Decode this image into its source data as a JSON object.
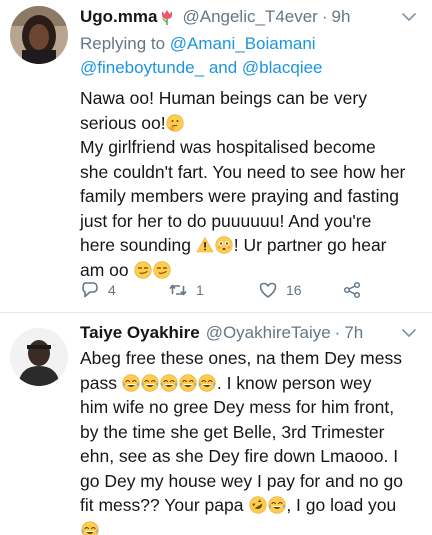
{
  "tweet1": {
    "display_name": "Ugo.mma",
    "handle": "@Angelic_T4ever",
    "separator": "·",
    "time": "9h",
    "replying_prefix": "Replying to",
    "replying_mention_1": "@Amani_Boiamani",
    "replying_mention_2": "@fineboytunde_",
    "replying_and": "and",
    "replying_mention_3": "@blacqiee",
    "line1": "Nawa oo! Human beings can be very",
    "line2": "serious oo!",
    "line3": "My girlfriend was hospitalised become",
    "line4": "she couldn't fart. You need to see how her",
    "line5": "family members were praying and fasting",
    "line6": "just for her to do puuuuuu! And you're",
    "line7a": "here sounding",
    "line7b": "! Ur partner go hear",
    "line8": "am oo",
    "reply_count": "4",
    "retweet_count": "1",
    "like_count": "16"
  },
  "tweet2": {
    "display_name": "Taiye Oyakhire",
    "handle": "@OyakhireTaiye",
    "separator": "·",
    "time": "7h",
    "line1": "Abeg free these ones, na them Dey mess",
    "line2a": "pass",
    "line2b": ". I know person wey",
    "line3": "him wife no gree Dey mess for him front,",
    "line4": "by the time she get Belle, 3rd Trimester",
    "line5": "ehn, see as she Dey fire down Lmaooo. I",
    "line6": "go Dey my house wey I pay for and no go",
    "line7a": "fit mess?? Your papa",
    "line7b": ", I go load you"
  },
  "colors": {
    "text": "#14171a",
    "secondary": "#657786",
    "link": "#1b95e0",
    "divider": "#e1e8ed"
  },
  "icons": [
    "tulip-icon",
    "thinking-face-icon",
    "warning-icon",
    "flushed-face-icon",
    "smirk-face-icon",
    "joy-face-icon",
    "rofl-face-icon",
    "reply-icon",
    "retweet-icon",
    "like-icon",
    "share-icon",
    "chevron-down-icon"
  ]
}
